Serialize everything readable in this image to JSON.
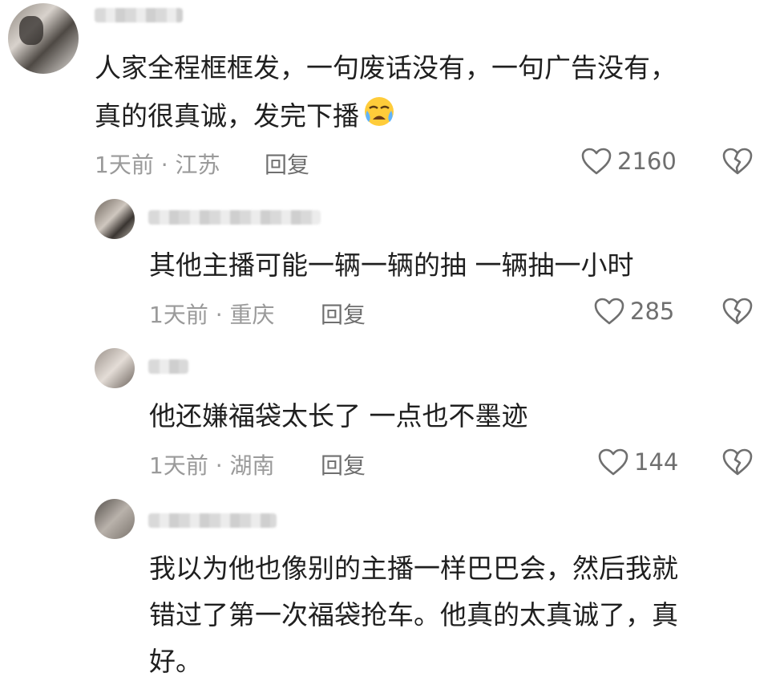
{
  "comments": [
    {
      "text_lines": [
        "人家全程框框发，一句废话没有，一句广告没有，",
        "真的很真诚，发完下播"
      ],
      "emoji": "crying-face-icon",
      "time": "1天前",
      "location": "江苏",
      "reply_label": "回复",
      "likes": "2160"
    },
    {
      "text_lines": [
        "其他主播可能一辆一辆的抽 一辆抽一小时"
      ],
      "time": "1天前",
      "location": "重庆",
      "reply_label": "回复",
      "likes": "285"
    },
    {
      "text_lines": [
        "他还嫌福袋太长了 一点也不墨迹"
      ],
      "time": "1天前",
      "location": "湖南",
      "reply_label": "回复",
      "likes": "144"
    },
    {
      "text_lines": [
        "我以为他也像别的主播一样巴巴会，然后我就",
        "错过了第一次福袋抢车。他真的太真诚了，真",
        "好。"
      ]
    }
  ],
  "meta_separator": "·",
  "colors": {
    "text": "#1f1f1f",
    "meta": "#9a9a9a",
    "action": "#6f6f6f"
  }
}
